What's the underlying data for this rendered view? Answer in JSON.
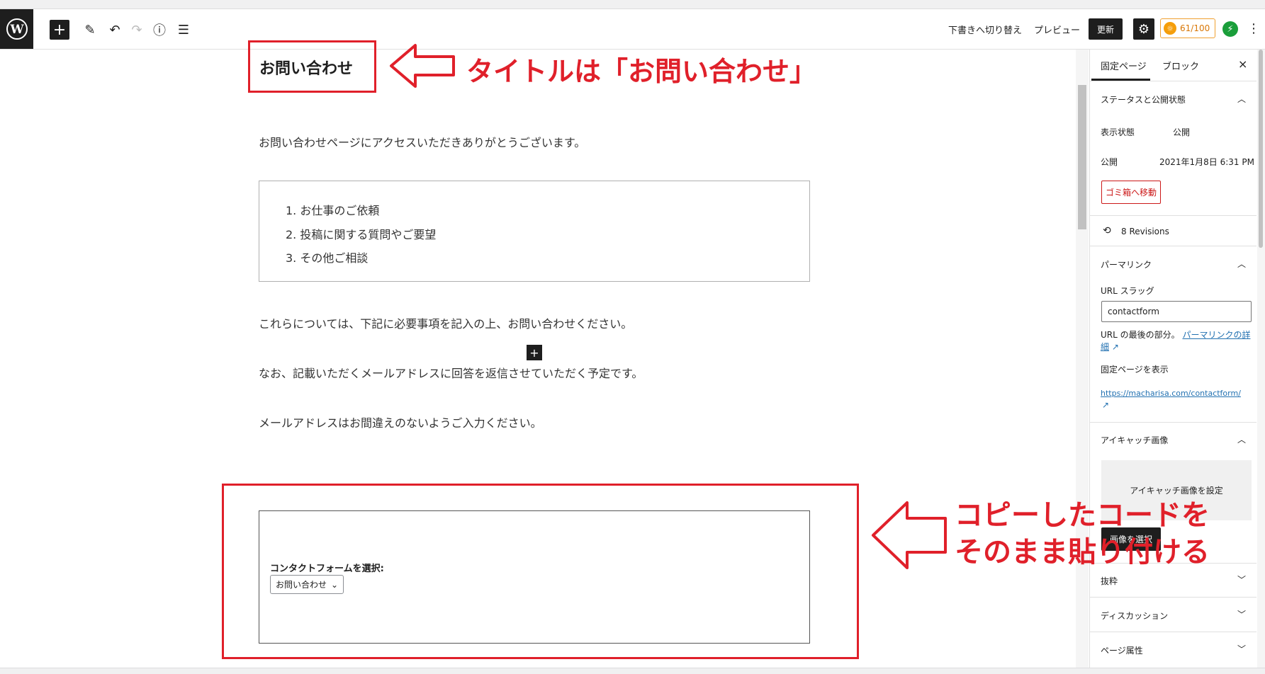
{
  "toolbar": {
    "add_label": "+",
    "switch_draft": "下書きへ切り替え",
    "preview": "プレビュー",
    "update": "更新",
    "score": "61/100",
    "score_icon": "sun-icon",
    "jetpack_icon": "bolt-icon"
  },
  "editor": {
    "title": "お問い合わせ",
    "para1": "お問い合わせページにアクセスいただきありがとうございます。",
    "list": [
      "お仕事のご依頼",
      "投稿に関する質問やご要望",
      "その他ご相談"
    ],
    "list_nums": [
      "1.",
      "2.",
      "3."
    ],
    "para2": "これらについては、下記に必要事項を記入の上、お問い合わせください。",
    "para3": "なお、記載いただくメールアドレスに回答を返信させていただく予定です。",
    "para4": "メールアドレスはお間違えのないようご入力ください。",
    "contact_form": {
      "label": "コンタクトフォームを選択:",
      "selected": "お問い合わせ"
    }
  },
  "annotations": {
    "title_note": "タイトルは「お問い合わせ」",
    "code_note_line1": "コピーしたコードを",
    "code_note_line2": "そのまま貼り付ける"
  },
  "sidebar": {
    "tab_page": "固定ページ",
    "tab_block": "ブロック",
    "close": "×",
    "status_heading": "ステータスと公開状態",
    "visibility_label": "表示状態",
    "visibility_value": "公開",
    "publish_label": "公開",
    "publish_value": "2021年1月8日 6:31 PM",
    "trash": "ゴミ箱へ移動",
    "revisions": "8 Revisions",
    "permalink_heading": "パーマリンク",
    "slug_label": "URL スラッグ",
    "slug_value": "contactform",
    "slug_help": "URL の最後の部分。",
    "slug_help_link": "パーマリンクの詳細",
    "view_page": "固定ページを表示",
    "page_url": "https://macharisa.com/contactform/",
    "featured_heading": "アイキャッチ画像",
    "featured_set": "アイキャッチ画像を設定",
    "media_select": "画像を選択",
    "excerpt_heading": "抜粋",
    "discussion_heading": "ディスカッション",
    "page_attr_heading": "ページ属性"
  },
  "colors": {
    "annotation_red": "#e0202a",
    "dark": "#1e1e1e",
    "link": "#2271b1"
  }
}
